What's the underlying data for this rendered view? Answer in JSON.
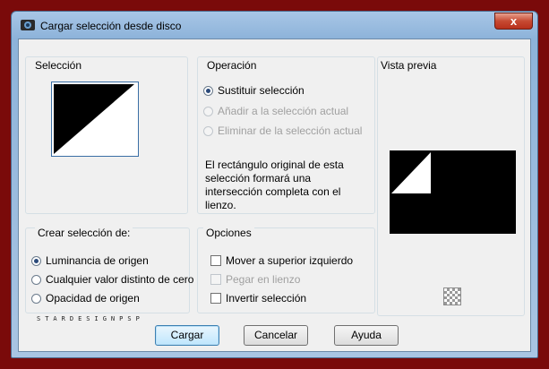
{
  "window": {
    "title": "Cargar selección desde disco",
    "close_glyph": "x"
  },
  "seleccion": {
    "label": "Selección"
  },
  "operacion": {
    "label": "Operación",
    "options": [
      "Sustituir selección",
      "Añadir a la selección actual",
      "Eliminar de la selección actual"
    ],
    "selected": 0,
    "info": "El rectángulo original de esta selección formará una intersección completa con el lienzo."
  },
  "vista_previa": {
    "label": "Vista previa"
  },
  "crear": {
    "label": "Crear selección de:",
    "options": [
      "Luminancia de origen",
      "Cualquier valor distinto de cero",
      "Opacidad de origen"
    ],
    "selected": 0
  },
  "opciones": {
    "label": "Opciones",
    "checks": [
      {
        "label": "Mover a superior izquierdo",
        "enabled": true,
        "checked": false
      },
      {
        "label": "Pegar en lienzo",
        "enabled": false,
        "checked": false
      },
      {
        "label": "Invertir selección",
        "enabled": true,
        "checked": false
      }
    ]
  },
  "watermark": "STARDESIGNPSP",
  "buttons": {
    "load": "Cargar",
    "cancel": "Cancelar",
    "help": "Ayuda"
  },
  "icons": {
    "app": "app-icon",
    "close": "close-icon",
    "checker": "transparency-checker-icon"
  }
}
